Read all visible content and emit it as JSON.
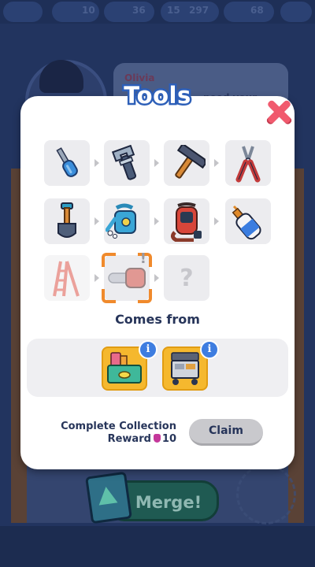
{
  "background": {
    "top_values": [
      "10",
      "36",
      "15",
      "297",
      "68"
    ],
    "speaker_name": "Olivia",
    "speech_text": "need your",
    "merge_label": "Merge!"
  },
  "modal": {
    "title": "Tools",
    "items": [
      {
        "name": "screwdriver",
        "state": "unlocked"
      },
      {
        "name": "wrench",
        "state": "unlocked"
      },
      {
        "name": "hammer",
        "state": "unlocked"
      },
      {
        "name": "pruning-shears",
        "state": "unlocked"
      },
      {
        "name": "shovel",
        "state": "unlocked"
      },
      {
        "name": "watering-can",
        "state": "unlocked"
      },
      {
        "name": "leaf-blower",
        "state": "unlocked"
      },
      {
        "name": "glue-bottle",
        "state": "unlocked"
      },
      {
        "name": "stepladder",
        "state": "locked"
      },
      {
        "name": "chainsaw",
        "state": "selected-locked"
      },
      {
        "name": "unknown",
        "state": "hidden",
        "label": "?"
      }
    ],
    "comes_from_label": "Comes from",
    "sources": [
      {
        "name": "toolbox",
        "info": "i"
      },
      {
        "name": "tool-cart",
        "info": "i"
      }
    ],
    "reward": {
      "line1": "Complete Collection",
      "line2_prefix": "Reward",
      "amount": "10",
      "claim_label": "Claim"
    }
  },
  "colors": {
    "title_outline": "#2d5fb8",
    "close": "#f15a6e",
    "source_bg": "#f5b82e",
    "info_badge": "#3e7de0",
    "selection": "#f08a2c"
  }
}
